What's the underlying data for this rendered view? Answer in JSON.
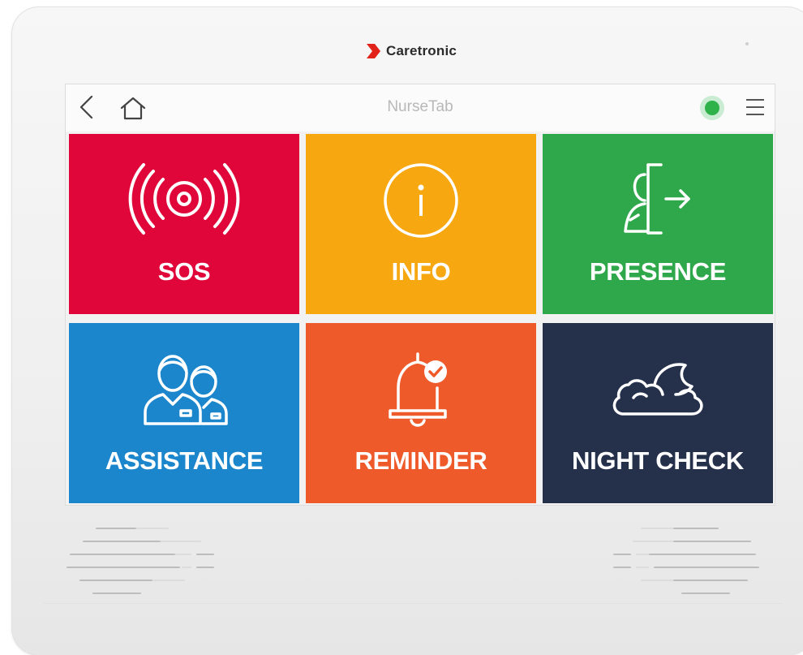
{
  "device": {
    "brand_name": "Caretronic",
    "brand_color": "#e2231a"
  },
  "topbar": {
    "title": "NurseTab",
    "back_icon": "chevron-left-icon",
    "home_icon": "home-icon",
    "status_icon": "status-online-dot",
    "status_color": "#2fb24a",
    "menu_icon": "hamburger-menu-icon"
  },
  "tiles": [
    {
      "label": "SOS",
      "icon": "alarm-signal-icon",
      "color": "#e0063a"
    },
    {
      "label": "INFO",
      "icon": "info-circle-icon",
      "color": "#f7a70f"
    },
    {
      "label": "PRESENCE",
      "icon": "person-exit-door-icon",
      "color": "#2ea84a"
    },
    {
      "label": "ASSISTANCE",
      "icon": "two-caregivers-icon",
      "color": "#1c86cd"
    },
    {
      "label": "REMINDER",
      "icon": "bell-check-icon",
      "color": "#ef5a2a"
    },
    {
      "label": "NIGHT CHECK",
      "icon": "moon-clouds-icon",
      "color": "#25304a"
    }
  ]
}
